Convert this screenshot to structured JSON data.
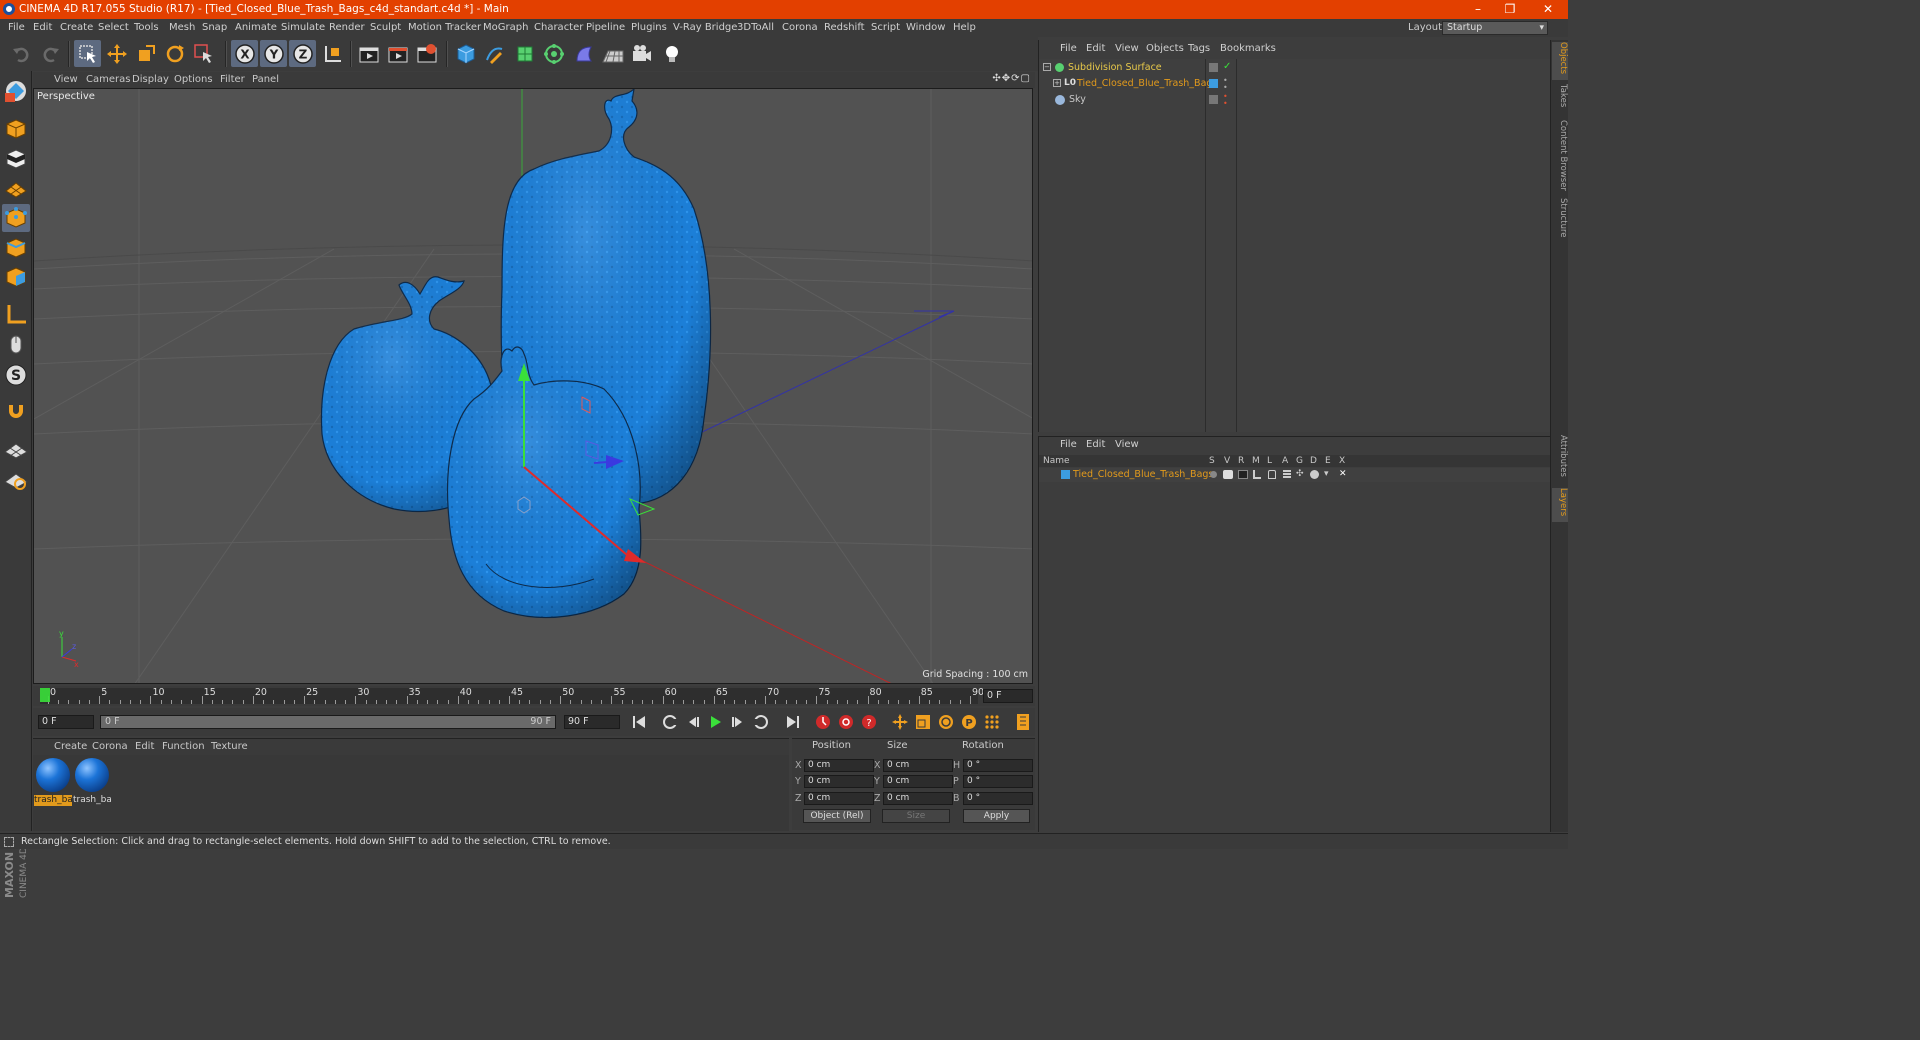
{
  "window": {
    "title": "CINEMA 4D R17.055 Studio (R17) - [Tied_Closed_Blue_Trash_Bags_c4d_standart.c4d *] - Main",
    "controls": [
      "–",
      "❐",
      "✕"
    ]
  },
  "menubar": {
    "items": [
      "File",
      "Edit",
      "Create",
      "Select",
      "Tools",
      "Mesh",
      "Snap",
      "Animate",
      "Simulate",
      "Render",
      "Sculpt",
      "Motion Tracker",
      "MoGraph",
      "Character",
      "Pipeline",
      "Plugins",
      "V-Ray Bridge",
      "3DToAll",
      "Corona",
      "Redshift",
      "Script",
      "Window",
      "Help"
    ],
    "layout_label": "Layout:",
    "layout_value": "Startup"
  },
  "toolbar": {
    "axis_x": "X",
    "axis_y": "Y",
    "axis_z": "Z"
  },
  "viewport": {
    "menu": [
      "View",
      "Cameras",
      "Display",
      "Options",
      "Filter",
      "Panel"
    ],
    "nav_icons": "✣✥⟳▢",
    "label": "Perspective",
    "grid_spacing": "Grid Spacing : 100 cm"
  },
  "timeline": {
    "ticks": [
      "0",
      "5",
      "10",
      "15",
      "20",
      "25",
      "30",
      "35",
      "40",
      "45",
      "50",
      "55",
      "60",
      "65",
      "70",
      "75",
      "80",
      "85",
      "90"
    ],
    "current_frame": "0 F"
  },
  "playback": {
    "start_field": "0 F",
    "range_start": "0 F",
    "range_end": "90 F",
    "end_field": "90 F"
  },
  "materials": {
    "menu": [
      "Create",
      "Corona",
      "Edit",
      "Function",
      "Texture"
    ],
    "items": [
      {
        "label": "trash_ba",
        "selected": true
      },
      {
        "label": "trash_ba",
        "selected": false
      }
    ]
  },
  "coordinates": {
    "headers": [
      "Position",
      "Size",
      "Rotation"
    ],
    "rows": [
      {
        "axis": "X",
        "pos": "0 cm",
        "size_axis": "X",
        "size": "0 cm",
        "rot_axis": "H",
        "rot": "0 °"
      },
      {
        "axis": "Y",
        "pos": "0 cm",
        "size_axis": "Y",
        "size": "0 cm",
        "rot_axis": "P",
        "rot": "0 °"
      },
      {
        "axis": "Z",
        "pos": "0 cm",
        "size_axis": "Z",
        "size": "0 cm",
        "rot_axis": "B",
        "rot": "0 °"
      }
    ],
    "mode": "Object (Rel)",
    "size_mode": "Size",
    "apply": "Apply"
  },
  "objects_panel": {
    "menu": [
      "File",
      "Edit",
      "View",
      "Objects",
      "Tags",
      "Bookmarks"
    ],
    "items": [
      {
        "name": "Subdivision Surface",
        "color": "#e8c94a"
      },
      {
        "name": "Tied_Closed_Blue_Trash_Bags",
        "color": "#e29a1c"
      },
      {
        "name": "Sky",
        "color": "#c8c8c8"
      }
    ]
  },
  "layers_panel": {
    "menu": [
      "File",
      "Edit",
      "View"
    ],
    "columns": [
      "Name",
      "S",
      "V",
      "R",
      "M",
      "L",
      "A",
      "G",
      "D",
      "E",
      "X"
    ],
    "layer_name": "Tied_Closed_Blue_Trash_Bags"
  },
  "side_tabs": [
    "Objects",
    "Takes",
    "Content Browser",
    "Structure",
    "Attributes",
    "Layers"
  ],
  "status": "Rectangle Selection: Click and drag to rectangle-select elements. Hold down SHIFT to add to the selection, CTRL to remove.",
  "brand": "MAXON CINEMA 4D",
  "colors": {
    "title_bar": "#e34000",
    "bag_blue": "#1c7fd8",
    "selection_orange": "#e29a1c"
  }
}
